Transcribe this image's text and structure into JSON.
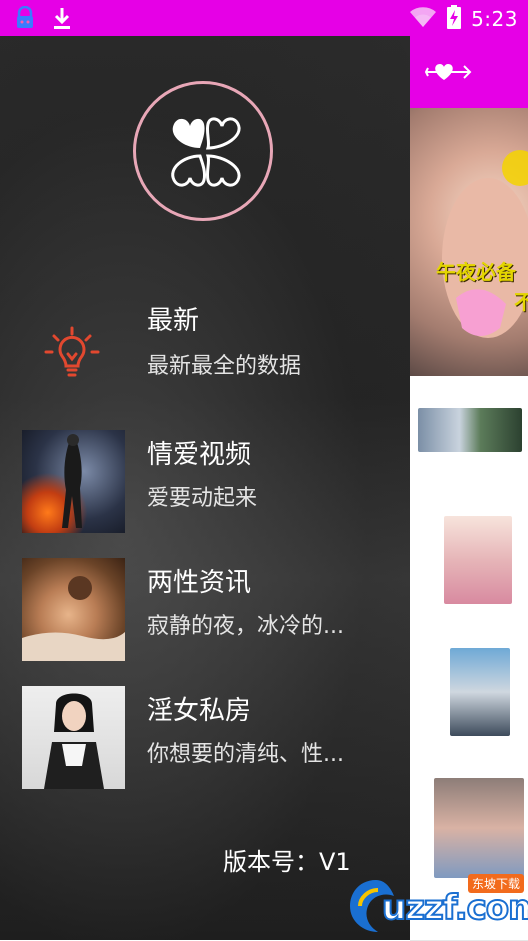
{
  "status_bar": {
    "time": "5:23",
    "icons": [
      "notification-app-icon",
      "download-icon",
      "wifi-icon",
      "battery-charging-icon"
    ]
  },
  "drawer": {
    "logo": "heart-clover-logo",
    "menu": [
      {
        "title": "最新",
        "subtitle": "最新最全的数据",
        "icon": "lightbulb-icon"
      },
      {
        "title": "情爱视频",
        "subtitle": "爱要动起来",
        "thumb": "video-thumb"
      },
      {
        "title": "两性资讯",
        "subtitle": "寂静的夜，冰冷的...",
        "thumb": "news-thumb"
      },
      {
        "title": "淫女私房",
        "subtitle": "你想要的清纯、性...",
        "thumb": "private-thumb"
      }
    ],
    "version_label": "版本号：V1"
  },
  "main": {
    "appbar_icon": "heart-arrow-icon",
    "banner_text_1": "午夜必备",
    "banner_text_2": "不"
  },
  "watermark": {
    "text": "uzzf.com",
    "tag": "东坡下载"
  },
  "colors": {
    "accent": "#e600e6",
    "lightbulb": "#e2482f",
    "logo_ring": "#e8a7b7"
  }
}
